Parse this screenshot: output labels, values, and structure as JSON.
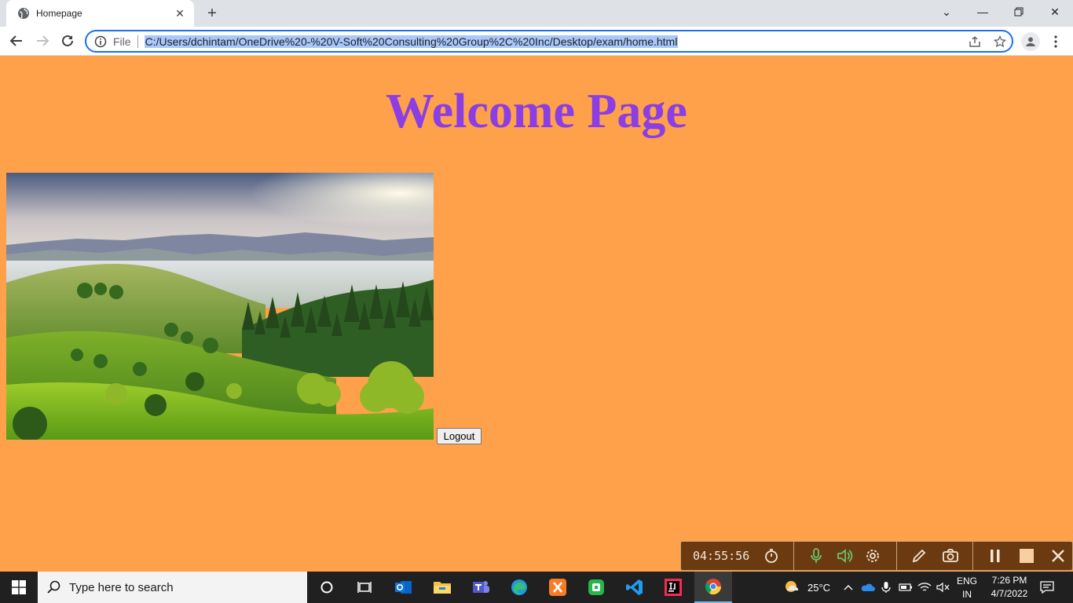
{
  "browser": {
    "tab_title": "Homepage",
    "scheme_label": "File",
    "url": "C:/Users/dchintam/OneDrive%20-%20V-Soft%20Consulting%20Group%2C%20Inc/Desktop/exam/home.html"
  },
  "page": {
    "heading": "Welcome Page",
    "logout_label": "Logout",
    "image_alt": "green hills landscape"
  },
  "recorder": {
    "elapsed": "04:55:56"
  },
  "taskbar": {
    "search_placeholder": "Type here to search",
    "weather": "25°C",
    "language_line1": "ENG",
    "language_line2": "IN",
    "time": "7:26 PM",
    "date": "4/7/2022"
  },
  "colors": {
    "page_bg": "#ffa04b",
    "heading": "#8a3ee3",
    "omnibox_focus": "#1a73e8"
  }
}
